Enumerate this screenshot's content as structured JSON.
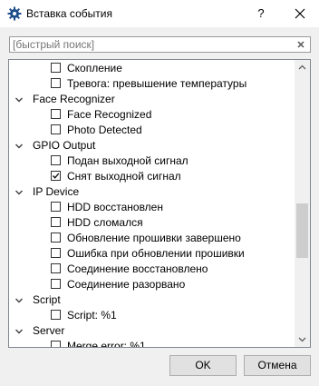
{
  "window": {
    "title": "Вставка события",
    "help_label": "?",
    "icons": {
      "app": "gear-icon",
      "close": "close-icon"
    }
  },
  "search": {
    "placeholder": "[быстрый поиск]",
    "value": "",
    "clear_icon": "clear-icon"
  },
  "tree": {
    "rows": [
      {
        "type": "item",
        "label": "Скопление",
        "checked": false
      },
      {
        "type": "item",
        "label": "Тревога: превышение температуры",
        "checked": false
      },
      {
        "type": "group",
        "label": "Face Recognizer",
        "expanded": true
      },
      {
        "type": "item",
        "label": "Face Recognized",
        "checked": false
      },
      {
        "type": "item",
        "label": "Photo Detected",
        "checked": false
      },
      {
        "type": "group",
        "label": "GPIO Output",
        "expanded": true
      },
      {
        "type": "item",
        "label": "Подан выходной сигнал",
        "checked": false
      },
      {
        "type": "item",
        "label": "Снят выходной сигнал",
        "checked": true
      },
      {
        "type": "group",
        "label": "IP Device",
        "expanded": true
      },
      {
        "type": "item",
        "label": "HDD восстановлен",
        "checked": false
      },
      {
        "type": "item",
        "label": "HDD сломался",
        "checked": false
      },
      {
        "type": "item",
        "label": "Обновление прошивки завершено",
        "checked": false
      },
      {
        "type": "item",
        "label": "Ошибка при обновлении прошивки",
        "checked": false
      },
      {
        "type": "item",
        "label": "Соединение восстановлено",
        "checked": false
      },
      {
        "type": "item",
        "label": "Соединение разорвано",
        "checked": false
      },
      {
        "type": "group",
        "label": "Script",
        "expanded": true
      },
      {
        "type": "item",
        "label": "Script: %1",
        "checked": false
      },
      {
        "type": "group",
        "label": "Server",
        "expanded": true
      },
      {
        "type": "item",
        "label": "Merge error: %1",
        "checked": false
      }
    ]
  },
  "buttons": {
    "ok": "OK",
    "cancel": "Отмена"
  },
  "colors": {
    "dialog_bg": "#f0f0f0",
    "titlebar_bg": "#ffffff",
    "list_border": "#828790",
    "scroll_thumb": "#cdcdcd"
  }
}
